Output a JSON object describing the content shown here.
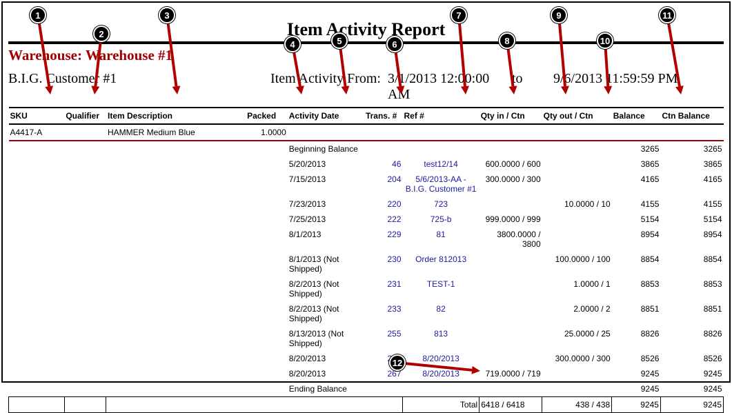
{
  "title": "Item Activity Report",
  "warehouse_line": "Warehouse: Warehouse #1",
  "customer": "B.I.G. Customer #1",
  "activity_label": "Item Activity From:",
  "from_dt": "3/1/2013 12:00:00 AM",
  "to_label": "to",
  "to_dt": "9/6/2013 11:59:59 PM",
  "headers": {
    "sku": "SKU",
    "qualifier": "Qualifier",
    "description": "Item Description",
    "packed": "Packed",
    "activity_date": "Activity Date",
    "trans": "Trans. #",
    "ref": "Ref #",
    "qty_in": "Qty in / Ctn",
    "qty_out": "Qty out / Ctn",
    "balance": "Balance",
    "ctn_balance": "Ctn Balance"
  },
  "item": {
    "sku": "A4417-A",
    "qualifier": "",
    "desc": "HAMMER Medium Blue",
    "packed": "1.0000"
  },
  "beginning_label": "Beginning Balance",
  "ending_label": "Ending Balance",
  "ending": {
    "balance": "9245",
    "ctn": "9245"
  },
  "beginning": {
    "balance": "3265",
    "ctn": "3265"
  },
  "rows": [
    {
      "date": "5/20/2013",
      "trans": "46",
      "ref": "test12/14",
      "qin": "600.0000 / 600",
      "qout": "",
      "bal": "3865",
      "cbal": "3865"
    },
    {
      "date": "7/15/2013",
      "trans": "204",
      "ref": "5/6/2013-AA - B.I.G. Customer #1",
      "qin": "300.0000 / 300",
      "qout": "",
      "bal": "4165",
      "cbal": "4165"
    },
    {
      "date": "7/23/2013",
      "trans": "220",
      "ref": "723",
      "qin": "",
      "qout": "10.0000 / 10",
      "bal": "4155",
      "cbal": "4155"
    },
    {
      "date": "7/25/2013",
      "trans": "222",
      "ref": "725-b",
      "qin": "999.0000 / 999",
      "qout": "",
      "bal": "5154",
      "cbal": "5154"
    },
    {
      "date": "8/1/2013",
      "trans": "229",
      "ref": "81",
      "qin": "3800.0000 / 3800",
      "qout": "",
      "bal": "8954",
      "cbal": "8954"
    },
    {
      "date": "8/1/2013 (Not Shipped)",
      "trans": "230",
      "ref": "Order 812013",
      "qin": "",
      "qout": "100.0000 / 100",
      "bal": "8854",
      "cbal": "8854"
    },
    {
      "date": "8/2/2013 (Not Shipped)",
      "trans": "231",
      "ref": "TEST-1",
      "qin": "",
      "qout": "1.0000 / 1",
      "bal": "8853",
      "cbal": "8853"
    },
    {
      "date": "8/2/2013 (Not Shipped)",
      "trans": "233",
      "ref": "82",
      "qin": "",
      "qout": "2.0000 / 2",
      "bal": "8851",
      "cbal": "8851"
    },
    {
      "date": "8/13/2013 (Not Shipped)",
      "trans": "255",
      "ref": "813",
      "qin": "",
      "qout": "25.0000 / 25",
      "bal": "8826",
      "cbal": "8826"
    },
    {
      "date": "8/20/2013",
      "trans": "266",
      "ref": "8/20/2013",
      "qin": "",
      "qout": "300.0000 / 300",
      "bal": "8526",
      "cbal": "8526"
    },
    {
      "date": "8/20/2013",
      "trans": "267",
      "ref": "8/20/2013",
      "qin": "719.0000 / 719",
      "qout": "",
      "bal": "9245",
      "cbal": "9245"
    }
  ],
  "totals": {
    "label": "Total",
    "qin": "6418 / 6418",
    "qout": "438 / 438",
    "bal": "9245",
    "cbal": "9245"
  },
  "callouts": [
    "1",
    "2",
    "3",
    "4",
    "5",
    "6",
    "7",
    "8",
    "9",
    "10",
    "11",
    "12"
  ]
}
